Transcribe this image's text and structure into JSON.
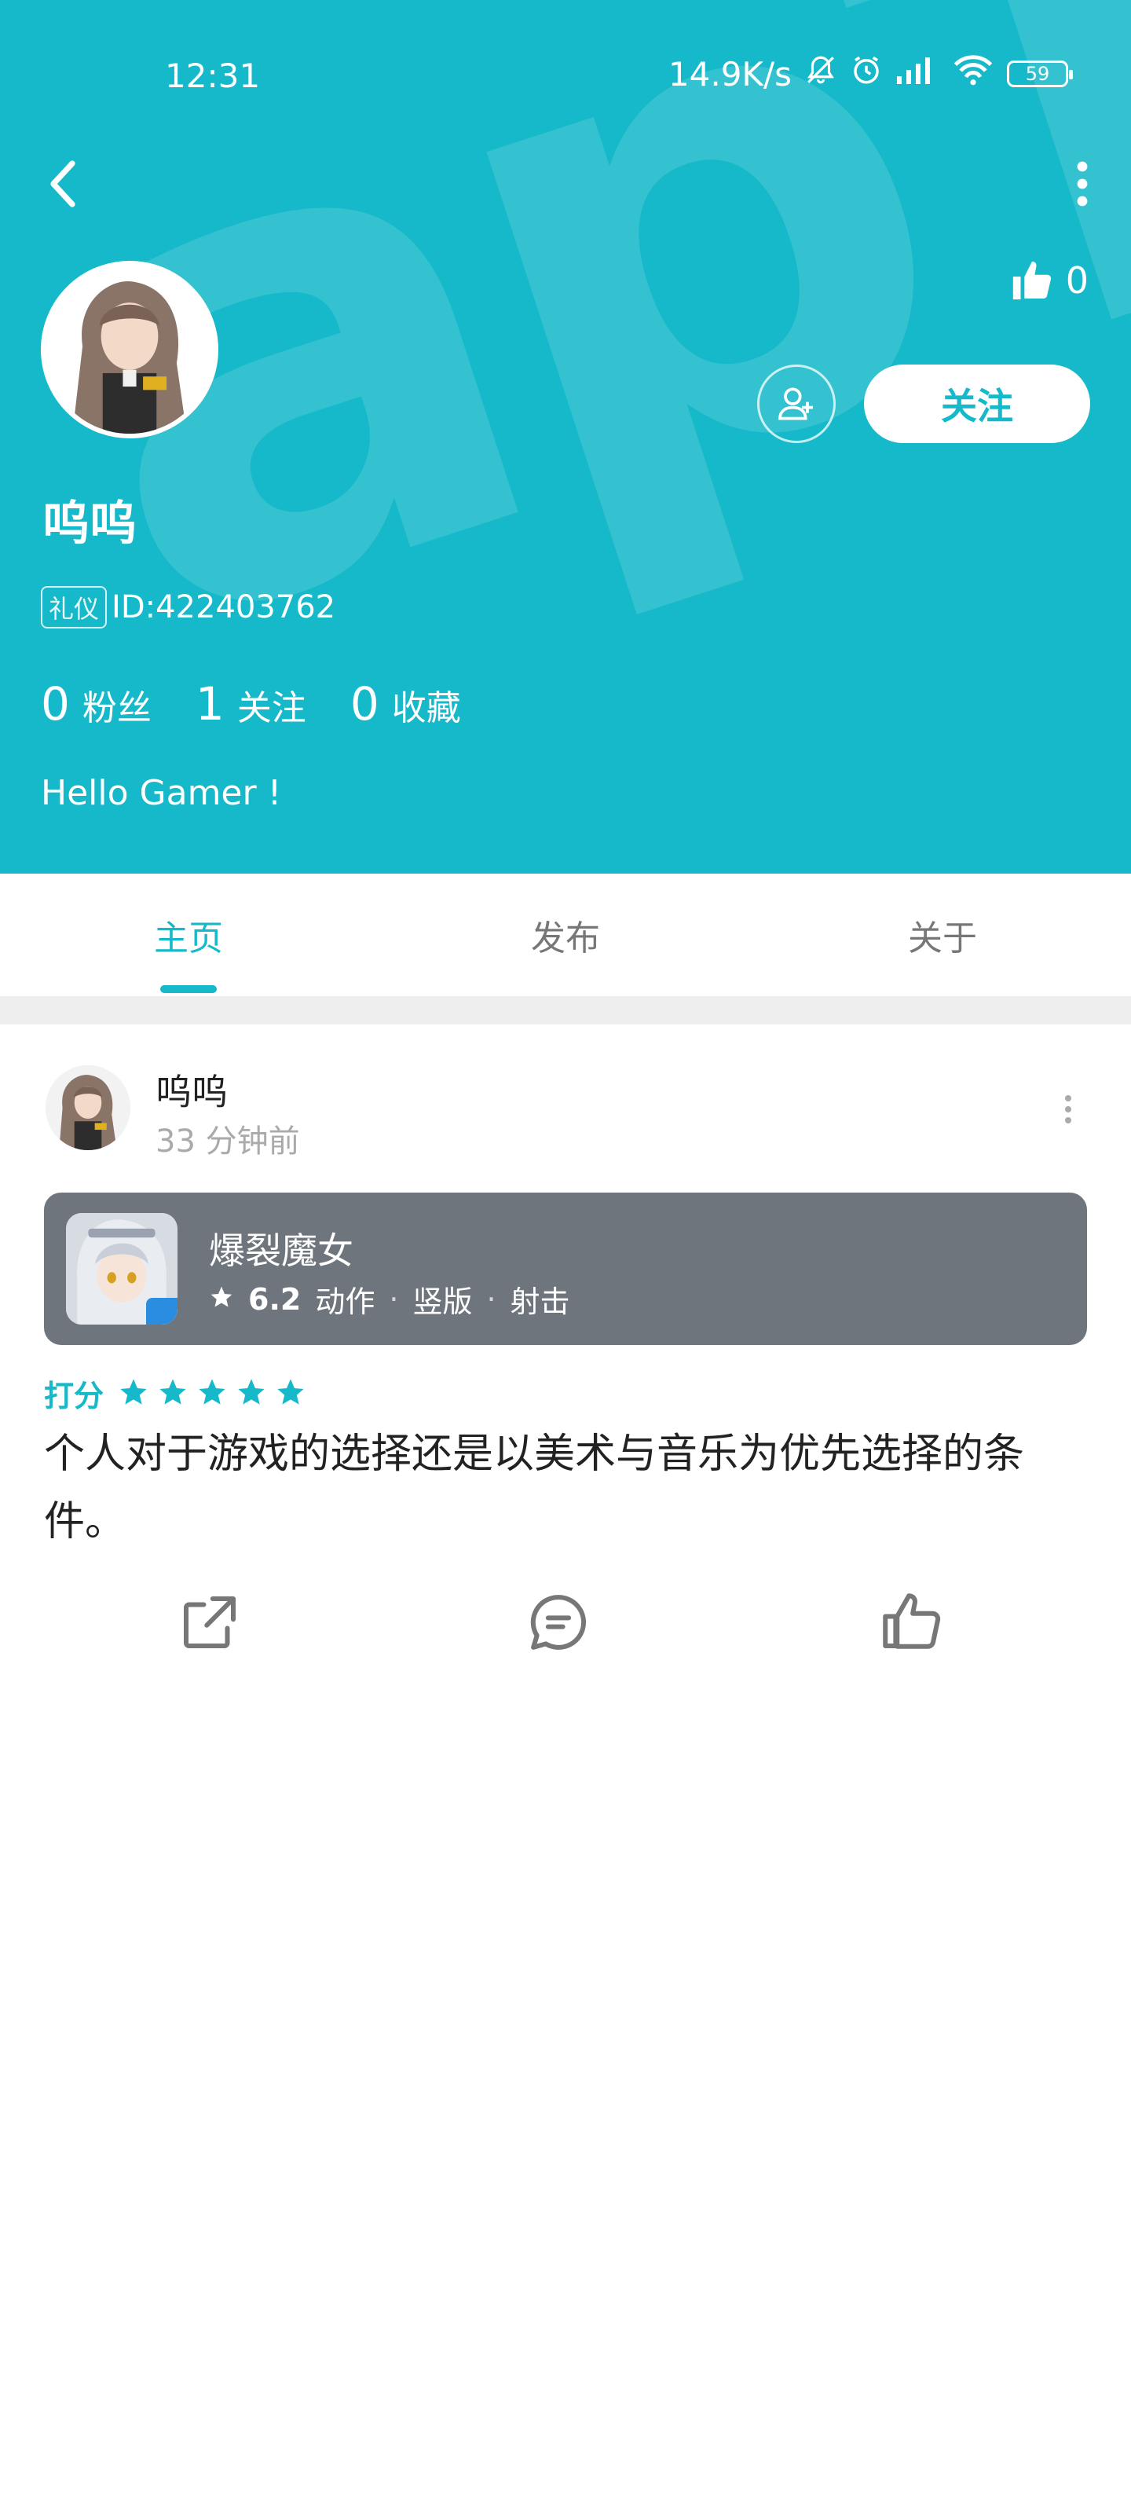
{
  "status_bar": {
    "time": "12:31",
    "speed": "14.9K/s",
    "battery": "59"
  },
  "profile": {
    "likes": "0",
    "follow_label": "关注",
    "name": "呜呜",
    "id_badge": "礼仪",
    "id_text": "ID:422403762",
    "stats": [
      {
        "value": "0",
        "label": "粉丝"
      },
      {
        "value": "1",
        "label": "关注"
      },
      {
        "value": "0",
        "label": "收藏"
      }
    ],
    "bio": "Hello Gamer !"
  },
  "tabs": [
    {
      "label": "主页",
      "active": true
    },
    {
      "label": "发布",
      "active": false
    },
    {
      "label": "关于",
      "active": false
    }
  ],
  "post": {
    "author": "呜呜",
    "time": "33 分钟前",
    "game": {
      "title": "爆裂魔女",
      "score": "6.2",
      "tags": [
        "动作",
        "竖版",
        "射击"
      ]
    },
    "rating_label": "打分",
    "rating_stars": 5,
    "review": "个人对于游戏的选择还是以美术与音乐为优先选择的条件。"
  },
  "colors": {
    "accent": "#16b9c9",
    "card": "#6f757c"
  },
  "icons": [
    "back-icon",
    "more-icon",
    "thumbs-up-icon",
    "add-friend-icon",
    "share-icon",
    "comment-icon",
    "like-icon"
  ]
}
